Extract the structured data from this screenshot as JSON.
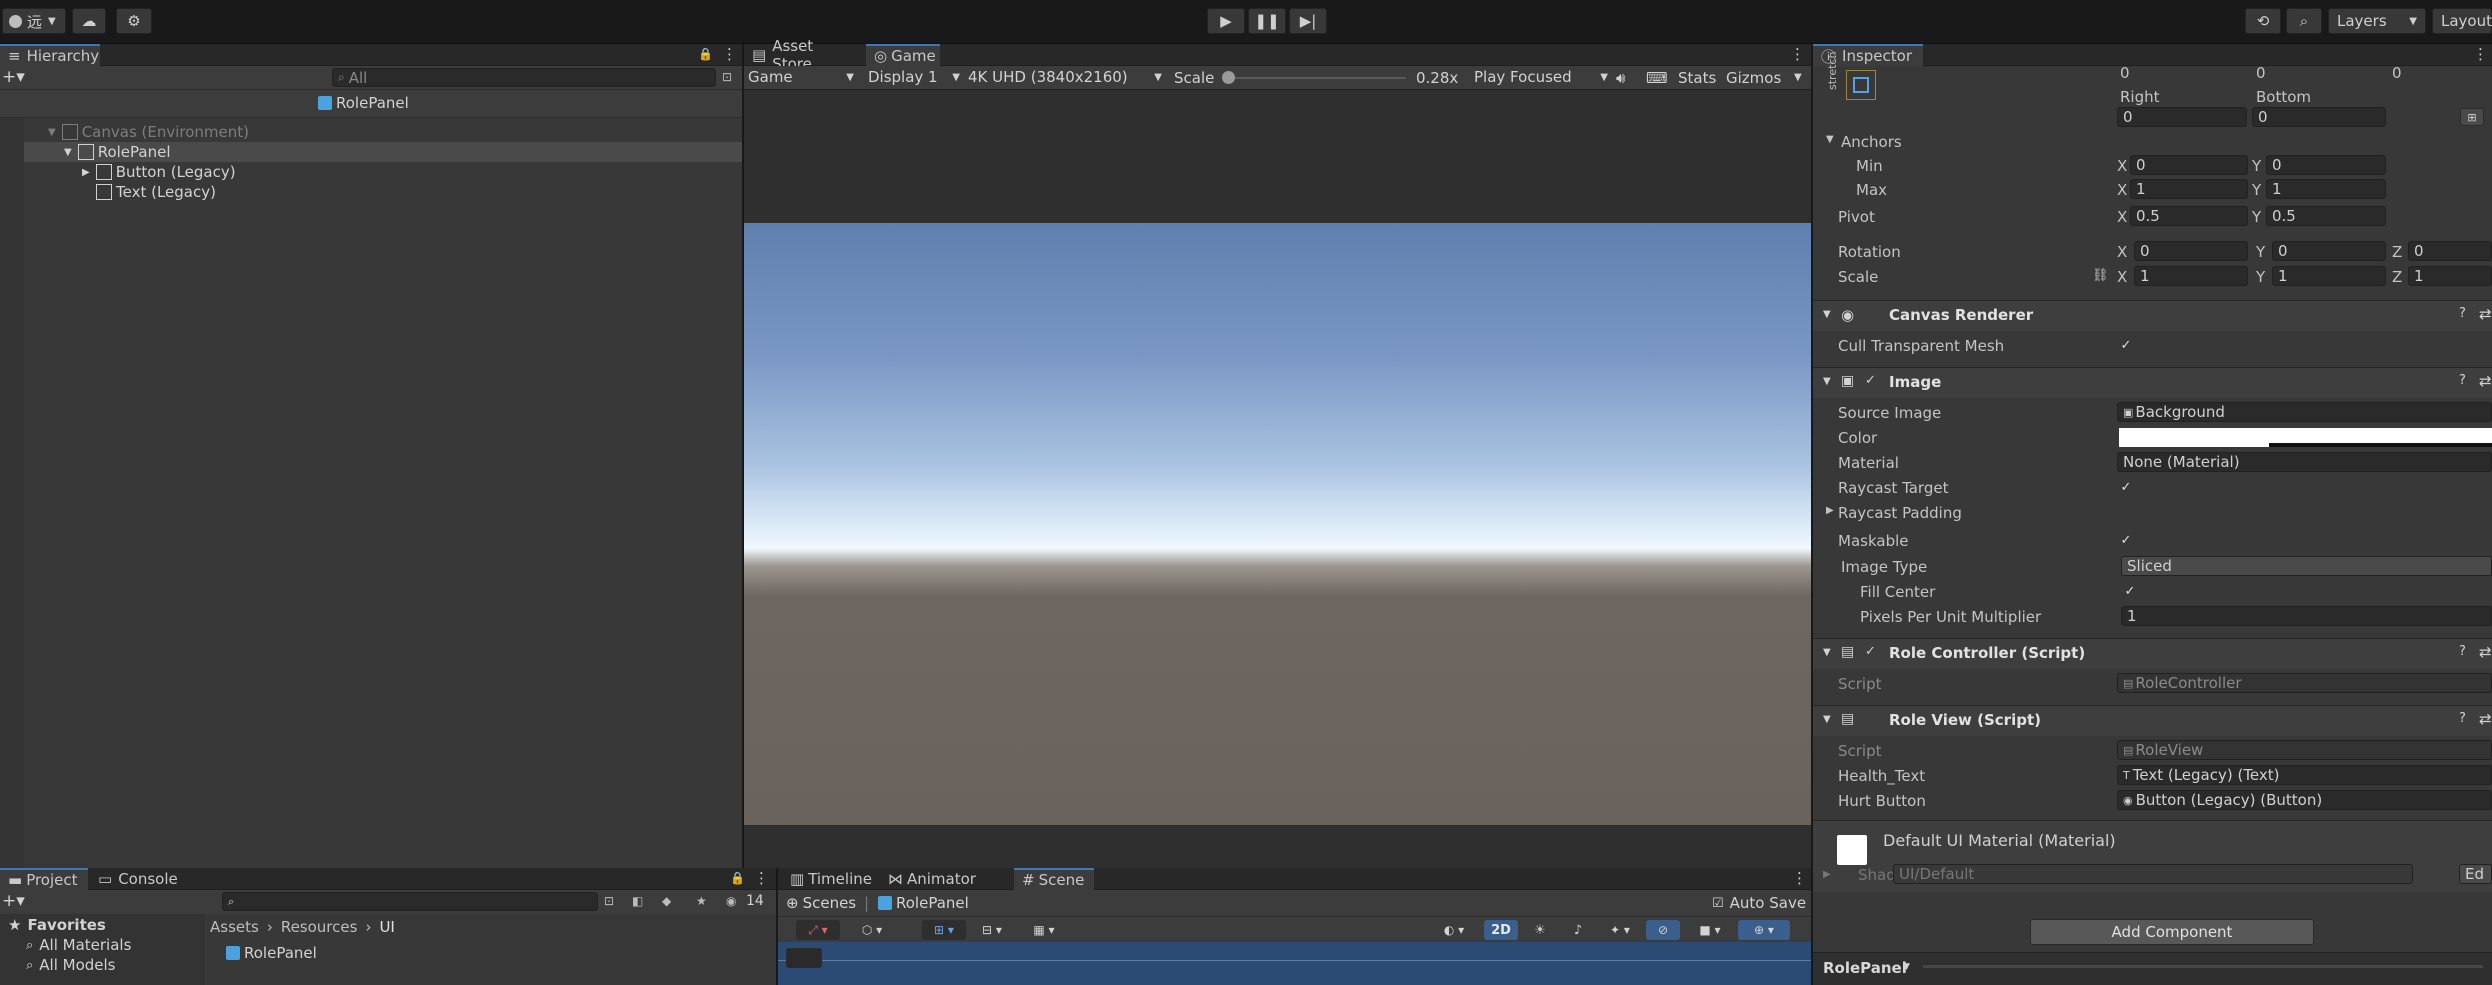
{
  "toolbar": {
    "account_label": "远",
    "layers_label": "Layers",
    "layout_label": "Layout",
    "play_icon": "play-icon",
    "pause_icon": "pause-icon",
    "step_icon": "step-icon"
  },
  "hierarchy": {
    "tab_label": "Hierarchy",
    "search_placeholder": "All",
    "header_title": "RolePanel",
    "items": [
      {
        "label": "Canvas (Environment)"
      },
      {
        "label": "RolePanel"
      },
      {
        "label": "Button (Legacy)"
      },
      {
        "label": "Text (Legacy)"
      }
    ]
  },
  "center": {
    "tabs": [
      {
        "label": "Asset Store"
      },
      {
        "label": "Game"
      }
    ],
    "game_toolbar": {
      "mode": "Game",
      "display": "Display 1",
      "resolution": "4K UHD (3840x2160)",
      "scale_label": "Scale",
      "scale_value": "0.28x",
      "play_focused": "Play Focused",
      "stats": "Stats",
      "gizmos": "Gizmos"
    }
  },
  "inspector": {
    "tab_label": "Inspector",
    "rect": {
      "stretch_label": "stretch",
      "top_values": [
        "0",
        "0",
        "0"
      ],
      "right_label": "Right",
      "bottom_label": "Bottom",
      "right_value": "0",
      "bottom_value": "0"
    },
    "anchors_label": "Anchors",
    "min_label": "Min",
    "max_label": "Max",
    "pivot_label": "Pivot",
    "rotation_label": "Rotation",
    "scale_label": "Scale",
    "x": "X",
    "y": "Y",
    "z": "Z",
    "anchor_min": [
      "0",
      "0"
    ],
    "anchor_max": [
      "1",
      "1"
    ],
    "pivot": [
      "0.5",
      "0.5"
    ],
    "rotation": [
      "0",
      "0",
      "0"
    ],
    "scale": [
      "1",
      "1",
      "1"
    ],
    "canvas_renderer": {
      "title": "Canvas Renderer",
      "cull_label": "Cull Transparent Mesh"
    },
    "image": {
      "title": "Image",
      "source_image_label": "Source Image",
      "source_image_value": "Background",
      "color_label": "Color",
      "material_label": "Material",
      "material_value": "None (Material)",
      "raycast_target_label": "Raycast Target",
      "raycast_padding_label": "Raycast Padding",
      "maskable_label": "Maskable",
      "image_type_label": "Image Type",
      "image_type_value": "Sliced",
      "fill_center_label": "Fill Center",
      "ppu_label": "Pixels Per Unit Multiplier",
      "ppu_value": "1"
    },
    "role_controller": {
      "title": "Role Controller (Script)",
      "script_label": "Script",
      "script_value": "RoleController"
    },
    "role_view": {
      "title": "Role View (Script)",
      "script_label": "Script",
      "script_value": "RoleView",
      "health_label": "Health_Text",
      "health_value": "Text (Legacy) (Text)",
      "hurt_label": "Hurt Button",
      "hurt_value": "Button (Legacy) (Button)"
    },
    "material": {
      "name": "Default UI Material (Material)",
      "shader_label": "Shader",
      "shader_value": "UI/Default",
      "edit_label": "Ed"
    },
    "add_component": "Add Component",
    "footer_label": "RolePanel"
  },
  "project": {
    "tabs": [
      {
        "label": "Project"
      },
      {
        "label": "Console"
      }
    ],
    "count": "14",
    "favorites_label": "Favorites",
    "favorites": [
      {
        "label": "All Materials"
      },
      {
        "label": "All Models"
      }
    ],
    "breadcrumb": [
      "Assets",
      "Resources",
      "UI"
    ],
    "asset_label": "RolePanel"
  },
  "bottom_center": {
    "tabs": [
      {
        "label": "Timeline"
      },
      {
        "label": "Animator"
      },
      {
        "label": "Scene"
      }
    ],
    "scenes_label": "Scenes",
    "scene_name": "RolePanel",
    "auto_save": "Auto Save",
    "mode_2d": "2D"
  },
  "colors": {
    "accent": "#3a79bb",
    "panel": "#383838",
    "sky_top": "#6a8ab8",
    "horizon": "#eaf4ff",
    "ground": "#6a625c"
  }
}
